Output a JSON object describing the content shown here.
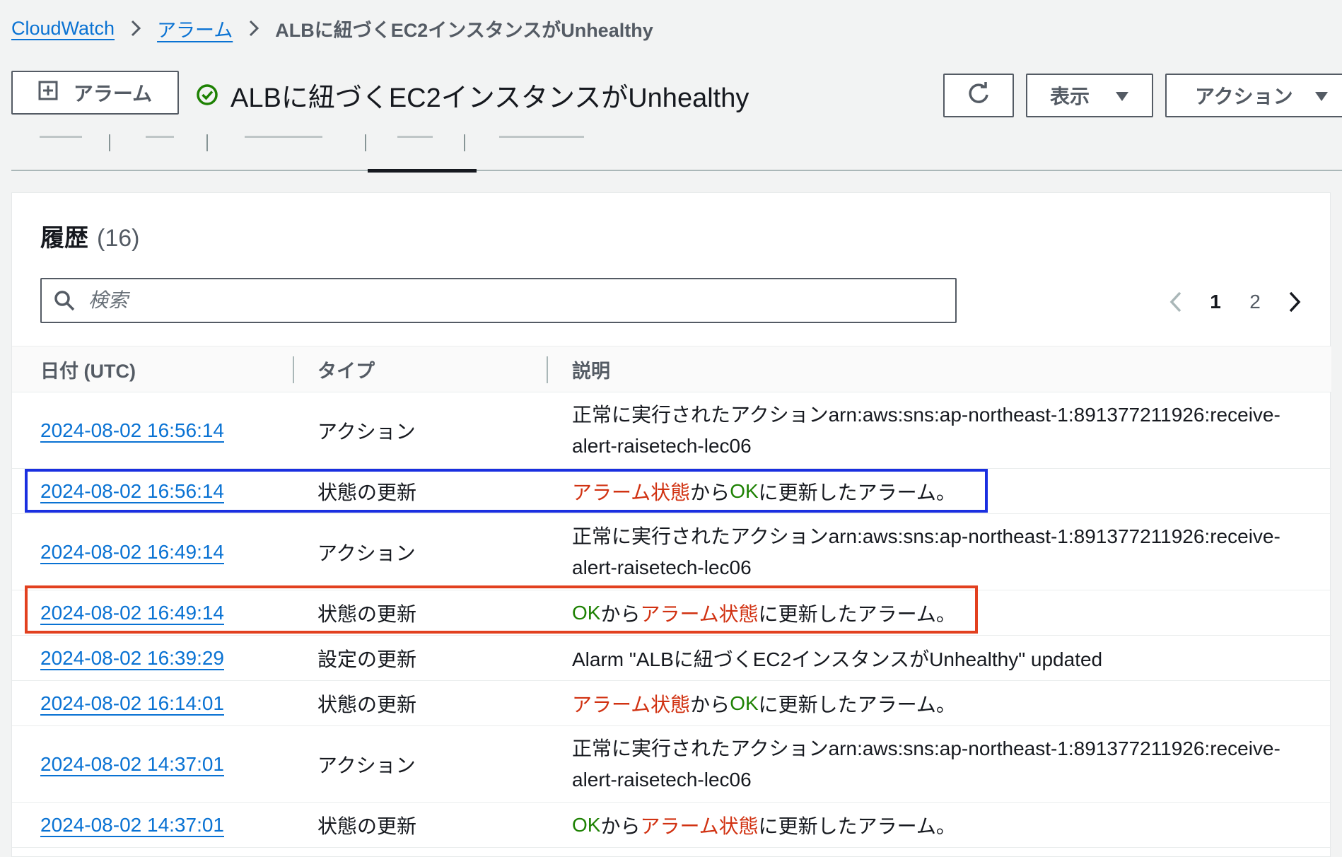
{
  "breadcrumb": {
    "items": [
      "CloudWatch",
      "アラーム"
    ],
    "current": "ALBに紐づくEC2インスタンスがUnhealthy"
  },
  "header": {
    "add_button_label": "アラーム",
    "title": "ALBに紐づくEC2インスタンスがUnhealthy",
    "status": "ok",
    "view_button_label": "表示",
    "actions_button_label": "アクション"
  },
  "tabs": {
    "active_index": 3
  },
  "history": {
    "title": "履歴",
    "count": "(16)",
    "search_placeholder": "検索",
    "pagination": {
      "pages": [
        "1",
        "2"
      ],
      "current": "1"
    },
    "columns": [
      "日付 (UTC)",
      "タイプ",
      "説明"
    ],
    "rows": [
      {
        "date": "2024-08-02 16:56:14",
        "type": "アクション",
        "desc_line1": "正常に実行されたアクションarn:aws:sns:ap-northeast-1:891377211926:receive-",
        "desc_line2": "alert-raisetech-lec06"
      },
      {
        "date": "2024-08-02 16:56:14",
        "type": "状態の更新",
        "desc_parts": [
          {
            "text": "アラーム状態",
            "tone": "red"
          },
          {
            "text": "から",
            "tone": "normal"
          },
          {
            "text": "OK",
            "tone": "green"
          },
          {
            "text": "に更新したアラーム。",
            "tone": "normal"
          }
        ],
        "highlight": "blue"
      },
      {
        "date": "2024-08-02 16:49:14",
        "type": "アクション",
        "desc_line1": "正常に実行されたアクションarn:aws:sns:ap-northeast-1:891377211926:receive-",
        "desc_line2": "alert-raisetech-lec06"
      },
      {
        "date": "2024-08-02 16:49:14",
        "type": "状態の更新",
        "desc_parts": [
          {
            "text": "OK",
            "tone": "green"
          },
          {
            "text": "から",
            "tone": "normal"
          },
          {
            "text": "アラーム状態",
            "tone": "red"
          },
          {
            "text": "に更新したアラーム。",
            "tone": "normal"
          }
        ],
        "highlight": "red"
      },
      {
        "date": "2024-08-02 16:39:29",
        "type": "設定の更新",
        "desc": "Alarm \"ALBに紐づくEC2インスタンスがUnhealthy\" updated"
      },
      {
        "date": "2024-08-02 16:14:01",
        "type": "状態の更新",
        "desc_parts": [
          {
            "text": "アラーム状態",
            "tone": "red"
          },
          {
            "text": "から",
            "tone": "normal"
          },
          {
            "text": "OK",
            "tone": "green"
          },
          {
            "text": "に更新したアラーム。",
            "tone": "normal"
          }
        ]
      },
      {
        "date": "2024-08-02 14:37:01",
        "type": "アクション",
        "desc_line1": "正常に実行されたアクションarn:aws:sns:ap-northeast-1:891377211926:receive-",
        "desc_line2": "alert-raisetech-lec06"
      },
      {
        "date": "2024-08-02 14:37:01",
        "type": "状態の更新",
        "desc_parts": [
          {
            "text": "OK",
            "tone": "green"
          },
          {
            "text": "から",
            "tone": "normal"
          },
          {
            "text": "アラーム状態",
            "tone": "red"
          },
          {
            "text": "に更新したアラーム。",
            "tone": "normal"
          }
        ]
      }
    ]
  },
  "colors": {
    "link": "#0972d3",
    "ok_green": "#1d8102",
    "alarm_red": "#d13212",
    "highlight_blue": "#1a2fe0",
    "highlight_red": "#e2401f"
  }
}
